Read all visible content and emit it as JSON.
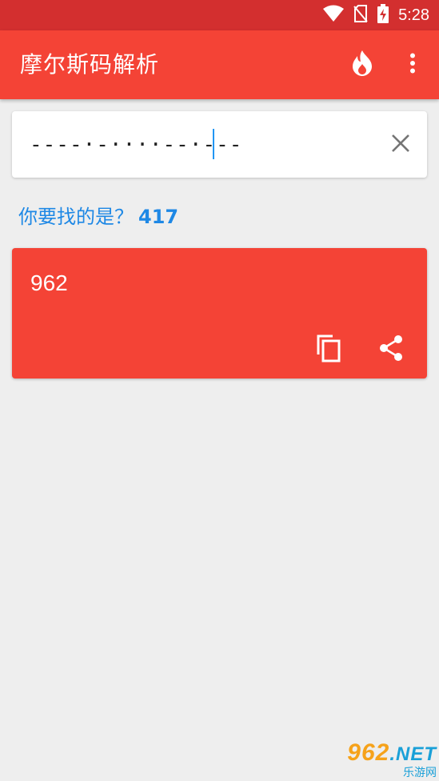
{
  "status_bar": {
    "time": "5:28",
    "icons": [
      "wifi-icon",
      "no-sim-icon",
      "battery-charging-icon"
    ]
  },
  "app_bar": {
    "title": "摩尔斯码解析",
    "actions": [
      "fire-icon",
      "more-vert-icon"
    ]
  },
  "input": {
    "value": "----·-····--·---"
  },
  "suggestion": {
    "prefix": "你要找的是？",
    "number": "417"
  },
  "result": {
    "text": "962",
    "actions": [
      "copy-icon",
      "share-icon"
    ]
  },
  "watermark": {
    "main": "962",
    "suffix": ".NET",
    "sub": "乐游网"
  },
  "colors": {
    "status_bar": "#d32f2f",
    "primary": "#f44336",
    "accent": "#1e88e5",
    "background": "#eeeeee"
  }
}
